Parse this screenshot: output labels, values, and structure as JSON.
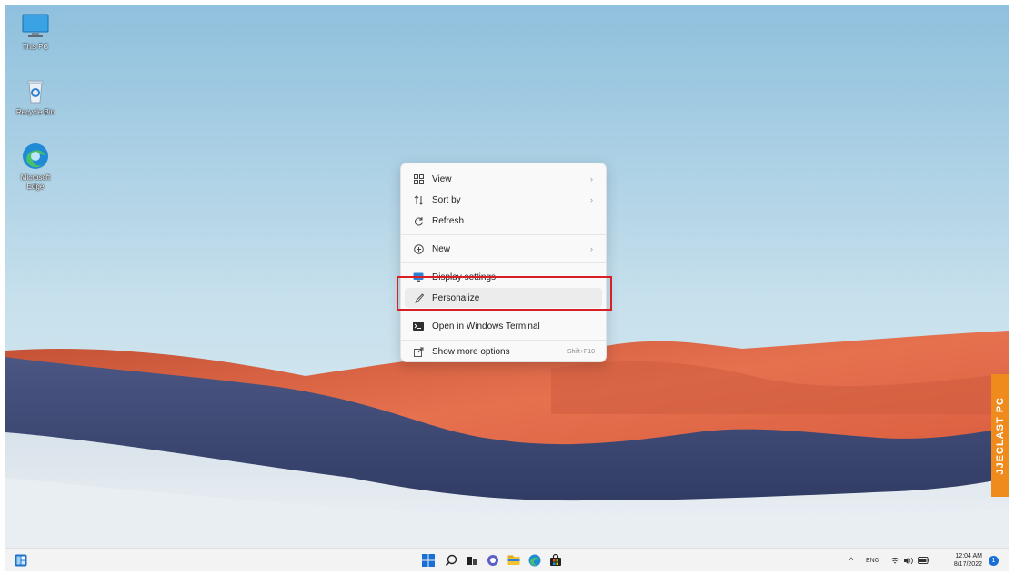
{
  "desktop": {
    "icons": [
      {
        "label": "This PC",
        "icon": "monitor-icon"
      },
      {
        "label": "Recycle Bin",
        "icon": "recycle-bin-icon"
      },
      {
        "label": "Microsoft Edge",
        "icon": "edge-icon"
      }
    ]
  },
  "context_menu": {
    "items": [
      {
        "label": "View",
        "icon": "grid-icon",
        "submenu": true
      },
      {
        "label": "Sort by",
        "icon": "sort-icon",
        "submenu": true
      },
      {
        "label": "Refresh",
        "icon": "refresh-icon"
      },
      {
        "label": "New",
        "icon": "plus-circle-icon",
        "submenu": true
      },
      {
        "label": "Display settings",
        "icon": "display-icon"
      },
      {
        "label": "Personalize",
        "icon": "brush-icon",
        "highlighted": true
      },
      {
        "label": "Open in Windows Terminal",
        "icon": "terminal-icon"
      },
      {
        "label": "Show more options",
        "icon": "share-icon",
        "shortcut": "Shift+F10"
      }
    ],
    "chevron": "›"
  },
  "watermark": {
    "text": "JJECLAST PC"
  },
  "taskbar": {
    "left_icon": "widgets-icon",
    "center_icons": [
      "start-icon",
      "search-icon",
      "task-view-icon",
      "chat-icon",
      "file-explorer-icon",
      "edge-icon",
      "store-icon"
    ],
    "tray": {
      "chevron": "^",
      "language": "ENG",
      "icons": [
        "wifi-icon",
        "volume-icon",
        "battery-icon"
      ],
      "time": "12:04 AM",
      "date": "8/17/2022",
      "notification_count": "1"
    }
  },
  "colors": {
    "highlight_box": "#d91f26",
    "sky": "#bcd9ea",
    "dunes_orange": "#e0684a",
    "dunes_navy": "#3f4a74",
    "watermark": "#ef8a1c"
  }
}
